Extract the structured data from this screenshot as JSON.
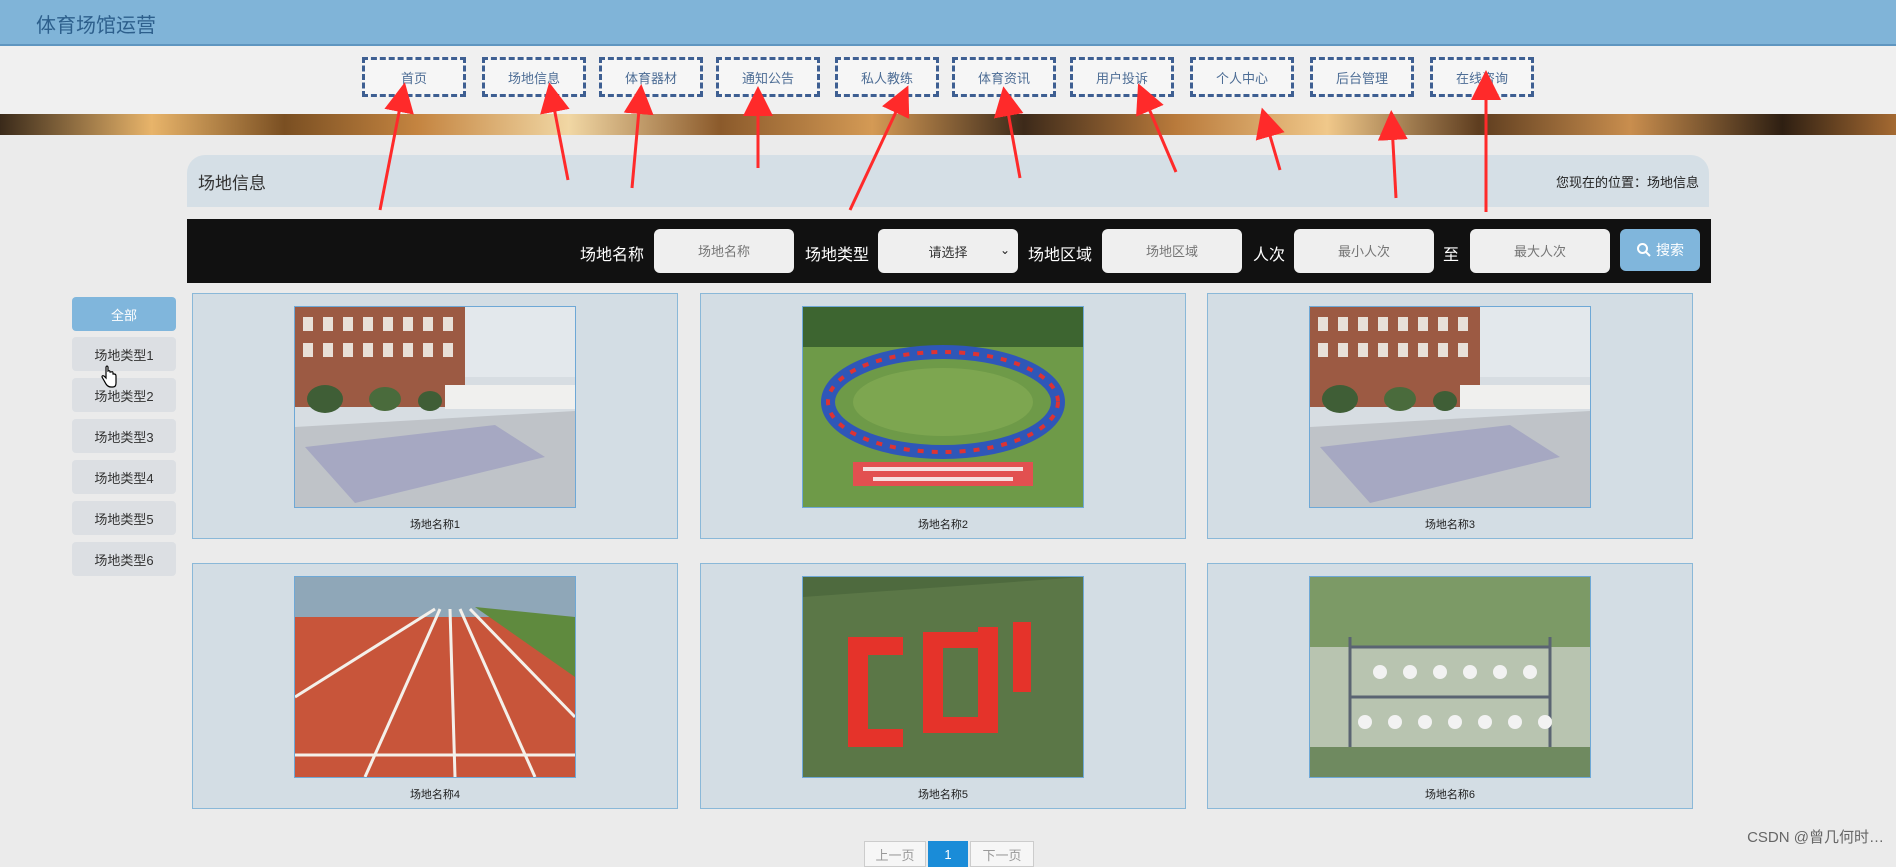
{
  "app": {
    "title": "体育场馆运营"
  },
  "nav": [
    {
      "label": "首页"
    },
    {
      "label": "场地信息"
    },
    {
      "label": "体育器材"
    },
    {
      "label": "通知公告"
    },
    {
      "label": "私人教练"
    },
    {
      "label": "体育资讯"
    },
    {
      "label": "用户投诉"
    },
    {
      "label": "个人中心"
    },
    {
      "label": "后台管理"
    },
    {
      "label": "在线咨询"
    }
  ],
  "breadcrumb": {
    "heading": "场地信息",
    "location": "您现在的位置：场地信息"
  },
  "search": {
    "name_label": "场地名称",
    "name_placeholder": "场地名称",
    "type_label": "场地类型",
    "type_selected": "请选择",
    "area_label": "场地区域",
    "area_placeholder": "场地区域",
    "count_label": "人次",
    "min_placeholder": "最小人次",
    "to_label": "至",
    "max_placeholder": "最大人次",
    "button_label": "搜索"
  },
  "categories": [
    {
      "label": "全部"
    },
    {
      "label": "场地类型1"
    },
    {
      "label": "场地类型2"
    },
    {
      "label": "场地类型3"
    },
    {
      "label": "场地类型4"
    },
    {
      "label": "场地类型5"
    },
    {
      "label": "场地类型6"
    }
  ],
  "venues": [
    {
      "name": "场地名称1"
    },
    {
      "name": "场地名称2"
    },
    {
      "name": "场地名称3"
    },
    {
      "name": "场地名称4"
    },
    {
      "name": "场地名称5"
    },
    {
      "name": "场地名称6"
    }
  ],
  "pagination": {
    "prev_label": "上一页",
    "current": "1",
    "next_label": "下一页"
  },
  "watermark": "CSDN @曾几何时…",
  "colors": {
    "accent": "#80b6dc",
    "annotation": "#ff2a2a",
    "dashed_border": "#3e5f92"
  }
}
